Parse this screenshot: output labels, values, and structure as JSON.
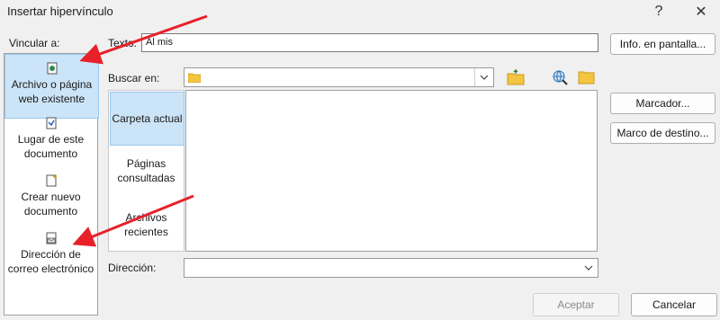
{
  "dialog": {
    "title": "Insertar hipervínculo",
    "help": "?",
    "close": "✕"
  },
  "link_to": {
    "label": "Vincular a:",
    "items": [
      {
        "label_line1": "Archivo o página",
        "label_line2": "web existente",
        "icon": "web-page-icon"
      },
      {
        "label_line1": "Lugar de este",
        "label_line2": "documento",
        "icon": "document-place-icon"
      },
      {
        "label_line1": "Crear nuevo",
        "label_line2": "documento",
        "icon": "new-document-icon"
      },
      {
        "label_line1": "Dirección de",
        "label_line2": "correo electrónico",
        "icon": "email-icon"
      }
    ]
  },
  "text_field": {
    "label": "Texto:",
    "value": "Al mis"
  },
  "screentip_button": "Info. en pantalla...",
  "look_in": {
    "label": "Buscar en:",
    "value": ""
  },
  "places": [
    {
      "line1": "Carpeta actual",
      "line2": ""
    },
    {
      "line1": "Páginas",
      "line2": "consultadas"
    },
    {
      "line1": "Archivos",
      "line2": "recientes"
    }
  ],
  "bookmark_button": "Marcador...",
  "target_frame_button": "Marco de destino...",
  "address": {
    "label": "Dirección:",
    "value": ""
  },
  "ok_button": "Aceptar",
  "cancel_button": "Cancelar",
  "colors": {
    "selection": "#cce4f7",
    "arrow": "#e8202a"
  }
}
